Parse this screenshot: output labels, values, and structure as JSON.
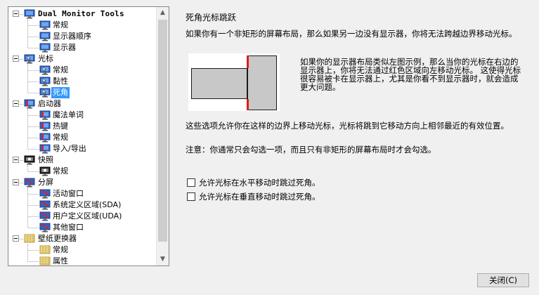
{
  "tree": {
    "items": [
      {
        "label": "Dual Monitor Tools",
        "level": 0,
        "icon": "monitor-icon",
        "root": true
      },
      {
        "label": "常规",
        "level": 1,
        "icon": "monitor-icon"
      },
      {
        "label": "显示器顺序",
        "level": 1,
        "icon": "monitor-icon"
      },
      {
        "label": "显示器",
        "level": 1,
        "icon": "monitor-icon"
      },
      {
        "label": "光标",
        "level": 0,
        "icon": "cursor-monitor-icon"
      },
      {
        "label": "常规",
        "level": 1,
        "icon": "cursor-monitor-icon"
      },
      {
        "label": "黏性",
        "level": 1,
        "icon": "cursor-monitor-icon"
      },
      {
        "label": "死角",
        "level": 1,
        "icon": "cursor-monitor-icon",
        "selected": true
      },
      {
        "label": "启动器",
        "level": 0,
        "icon": "launcher-monitor-icon"
      },
      {
        "label": "魔法单词",
        "level": 1,
        "icon": "launcher-monitor-icon"
      },
      {
        "label": "热键",
        "level": 1,
        "icon": "launcher-monitor-icon"
      },
      {
        "label": "常规",
        "level": 1,
        "icon": "launcher-monitor-icon"
      },
      {
        "label": "导入/导出",
        "level": 1,
        "icon": "launcher-monitor-icon"
      },
      {
        "label": "快照",
        "level": 0,
        "icon": "camera-monitor-icon"
      },
      {
        "label": "常规",
        "level": 1,
        "icon": "camera-monitor-icon"
      },
      {
        "label": "分屏",
        "level": 0,
        "icon": "split-monitor-icon"
      },
      {
        "label": "活动窗口",
        "level": 1,
        "icon": "split-monitor-icon"
      },
      {
        "label": "系统定义区域(SDA)",
        "level": 1,
        "icon": "split-monitor-icon"
      },
      {
        "label": "用户定义区域(UDA)",
        "level": 1,
        "icon": "split-monitor-icon"
      },
      {
        "label": "其他窗口",
        "level": 1,
        "icon": "split-monitor-icon"
      },
      {
        "label": "壁纸更换器",
        "level": 0,
        "icon": "wallpaper-icon"
      },
      {
        "label": "常规",
        "level": 1,
        "icon": "wallpaper-icon"
      },
      {
        "label": "属性",
        "level": 1,
        "icon": "wallpaper-icon"
      }
    ],
    "scroll_up_glyph": "▲",
    "scroll_down_glyph": "▼"
  },
  "content": {
    "title": "死角光标跳跃",
    "description": "如果你有一个非矩形的屏幕布局，那么如果另一边没有显示器，你将无法跨越边界移动光标。",
    "diagram_explanation": "如果你的显示器布局类似左图示例，那么当你的光标在右边的显示器上，你将无法通过红色区域向左移动光标。 这使得光标很容易被卡在显示器上，尤其是你看不到显示器时，就会造成更大问题。",
    "allow_text": "这些选项允许你在这样的边界上移动光标，光标将跳到它移动方向上相邻最近的有效位置。",
    "note": "注意：你通常只会勾选一项，而且只有非矩形的屏幕布局时才会勾选。",
    "checkbox_horizontal": "允许光标在水平移动时跳过死角。",
    "checkbox_vertical": "允许光标在垂直移动时跳过死角。"
  },
  "footer": {
    "close_label": "关闭(C)"
  },
  "colors": {
    "selection": "#3399ff",
    "dead_zone": "#e21b1b"
  }
}
